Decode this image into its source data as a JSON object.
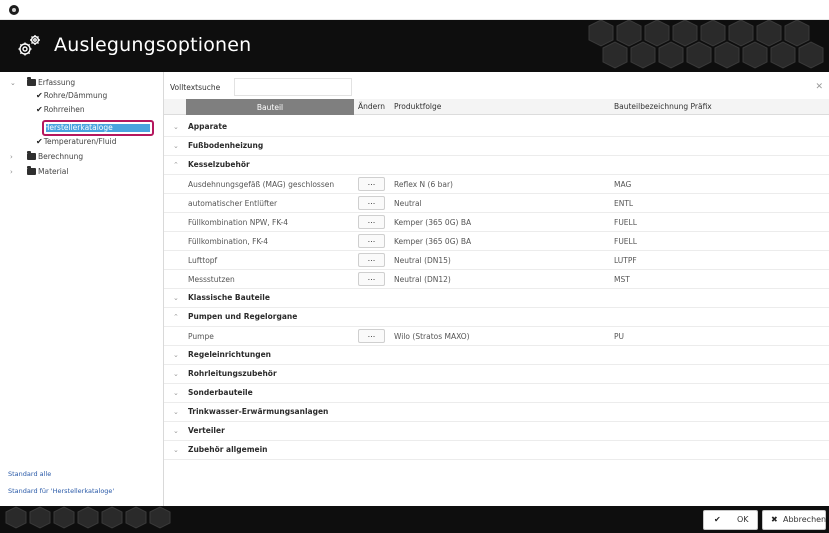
{
  "header": {
    "title": "Auslegungsoptionen"
  },
  "sidebar": {
    "tree": [
      {
        "label": "Erfassung",
        "kind": "folder-open",
        "expanded": true
      },
      {
        "label": "Rohre/Dämmung",
        "kind": "check"
      },
      {
        "label": "Rohrreihen",
        "kind": "check"
      },
      {
        "label": "Herstellerkataloge",
        "kind": "check",
        "selected": true
      },
      {
        "label": "Temperaturen/Fluid",
        "kind": "check"
      },
      {
        "label": "Berechnung",
        "kind": "folder",
        "expanded": false
      },
      {
        "label": "Material",
        "kind": "folder",
        "expanded": false
      }
    ],
    "links": [
      "Standard alle",
      "Standard für 'Herstellerkataloge'"
    ]
  },
  "search": {
    "label": "Volltextsuche",
    "value": "",
    "placeholder": ""
  },
  "table": {
    "columns": [
      "Bauteil",
      "Ändern",
      "Produktfolge",
      "Bauteilbezeichnung Präfix"
    ],
    "edit_label": "...",
    "groups": [
      {
        "name": "Apparate",
        "expanded": false,
        "items": []
      },
      {
        "name": "Fußbodenheizung",
        "expanded": false,
        "items": []
      },
      {
        "name": "Kesselzubehör",
        "expanded": true,
        "items": [
          {
            "bauteil": "Ausdehnungsgefäß (MAG) geschlossen",
            "produktfolge": "Reflex N (6 bar)",
            "praefix": "MAG"
          },
          {
            "bauteil": "automatischer Entlüfter",
            "produktfolge": "Neutral",
            "praefix": "ENTL"
          },
          {
            "bauteil": "Füllkombination NPW, FK-4",
            "produktfolge": "Kemper (365 0G) BA",
            "praefix": "FUELL"
          },
          {
            "bauteil": "Füllkombination, FK-4",
            "produktfolge": "Kemper (365 0G) BA",
            "praefix": "FUELL"
          },
          {
            "bauteil": "Lufttopf",
            "produktfolge": "Neutral (DN15)",
            "praefix": "LUTPF"
          },
          {
            "bauteil": "Messstutzen",
            "produktfolge": "Neutral (DN12)",
            "praefix": "MST"
          }
        ]
      },
      {
        "name": "Klassische Bauteile",
        "expanded": false,
        "items": []
      },
      {
        "name": "Pumpen und Regelorgane",
        "expanded": true,
        "items": [
          {
            "bauteil": "Pumpe",
            "produktfolge": "Wilo (Stratos MAXO)",
            "praefix": "PU"
          }
        ]
      },
      {
        "name": "Regeleinrichtungen",
        "expanded": false,
        "items": []
      },
      {
        "name": "Rohrleitungszubehör",
        "expanded": false,
        "items": []
      },
      {
        "name": "Sonderbauteile",
        "expanded": false,
        "items": []
      },
      {
        "name": "Trinkwasser-Erwärmungsanlagen",
        "expanded": false,
        "items": []
      },
      {
        "name": "Verteiler",
        "expanded": false,
        "items": []
      },
      {
        "name": "Zubehör allgemein",
        "expanded": false,
        "items": []
      }
    ]
  },
  "footer": {
    "ok_label": "OK",
    "cancel_label": "Abbrechen"
  },
  "colors": {
    "selection": "#4aa3df",
    "highlight_frame": "#b5175e",
    "header_bg": "#0e0e0e",
    "link": "#2a5aa8"
  }
}
